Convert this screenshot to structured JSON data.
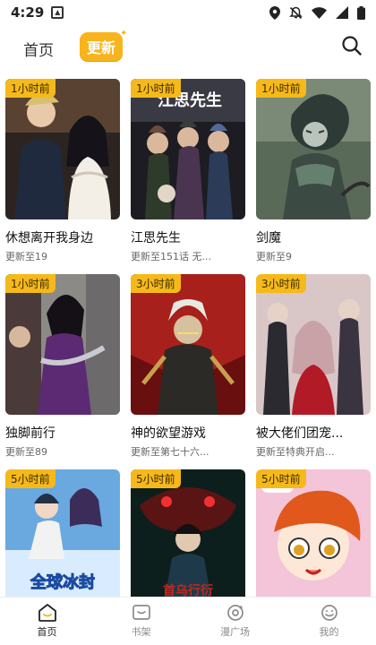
{
  "status_bar": {
    "time": "4:29"
  },
  "header": {
    "home_tab": "首页",
    "update_tab": "更新"
  },
  "colors": {
    "accent": "#f8b41c",
    "badge": "#f6b91a"
  },
  "comics": [
    {
      "badge": "1小时前",
      "title": "休想离开我身边",
      "sub": "更新至19",
      "cover_text": ""
    },
    {
      "badge": "1小时前",
      "title": "江思先生",
      "sub": "更新至151话 无...",
      "cover_text": "江思先生"
    },
    {
      "badge": "1小时前",
      "title": "剑魔",
      "sub": "更新至9",
      "cover_text": ""
    },
    {
      "badge": "1小时前",
      "title": "独脚前行",
      "sub": "更新至89",
      "cover_text": ""
    },
    {
      "badge": "3小时前",
      "title": "神的欲望游戏",
      "sub": "更新至第七十六...",
      "cover_text": ""
    },
    {
      "badge": "3小时前",
      "title": "被大佬们团宠...",
      "sub": "更新至特典开启...",
      "cover_text": ""
    },
    {
      "badge": "5小时前",
      "title": "",
      "sub": "",
      "cover_text": "全球冰封"
    },
    {
      "badge": "5小时前",
      "title": "",
      "sub": "",
      "cover_text": "首乌行衍"
    },
    {
      "badge": "5小时前",
      "title": "",
      "sub": "",
      "cover_text": ""
    }
  ],
  "bottom_nav": [
    {
      "label": "首页",
      "icon": "home-icon"
    },
    {
      "label": "书架",
      "icon": "bookshelf-icon"
    },
    {
      "label": "漫广场",
      "icon": "plaza-icon"
    },
    {
      "label": "我的",
      "icon": "profile-icon"
    }
  ]
}
